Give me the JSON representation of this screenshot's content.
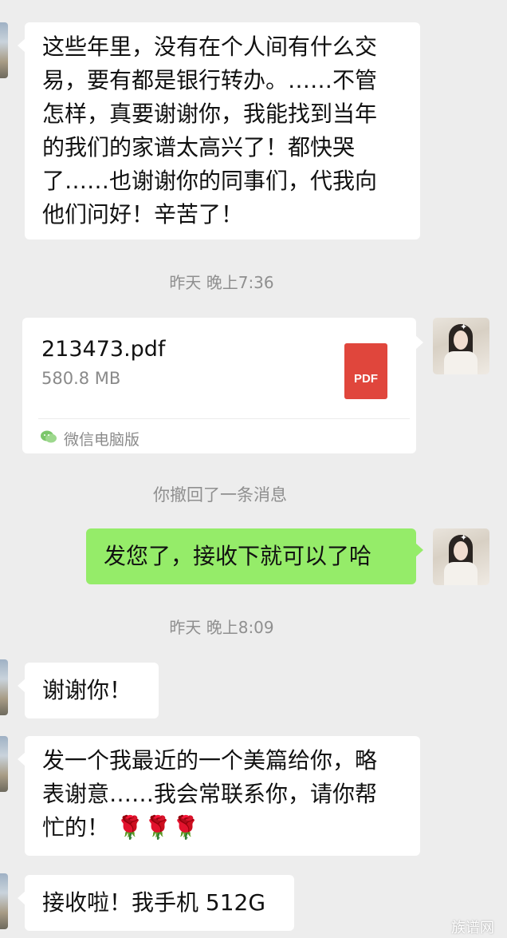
{
  "messages": {
    "m1": {
      "lines": [
        "这些年里，没有在个人间有什么交",
        "易，要有都是银行转办。……不管",
        "怎样，真要谢谢你，我能找到当年",
        "的我们的家谱太高兴了！都快哭",
        "了……也谢谢你的同事们，代我向",
        "他们问好！辛苦了！"
      ]
    },
    "timestamp_1": "昨天 晚上7:36",
    "file": {
      "name": "213473.pdf",
      "size": "580.8 MB",
      "icon_label": "PDF",
      "source": "微信电脑版"
    },
    "recalled": "你撤回了一条消息",
    "m2": {
      "text": "发您了，接收下就可以了哈"
    },
    "timestamp_2": "昨天 晚上8:09",
    "m3": {
      "text": "谢谢你！"
    },
    "m4": {
      "lines": [
        "发一个我最近的一个美篇给你，略",
        "表谢意……我会常联系你，请你帮",
        "忙的！"
      ],
      "emoji": "🌹🌹🌹"
    },
    "m5": {
      "text": "接收啦！我手机 512G"
    }
  },
  "watermark": "族谱网",
  "colors": {
    "background": "#ededed",
    "incoming_bubble": "#ffffff",
    "outgoing_bubble": "#95ec69",
    "pdf_icon": "#e0463c"
  },
  "icons": [
    "avatar-contact",
    "avatar-self",
    "pdf-file-icon",
    "wechat-icon",
    "rose-emoji"
  ]
}
